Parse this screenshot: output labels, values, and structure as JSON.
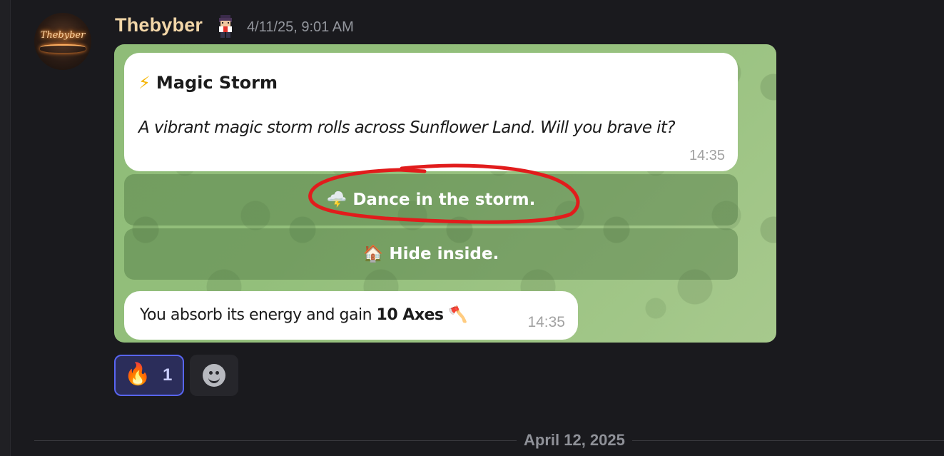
{
  "message": {
    "username": "Thebyber",
    "timestamp": "4/11/25, 9:01 AM",
    "avatar_text": "Thebyber",
    "badge_icon": "pixel-character-badge"
  },
  "embed": {
    "bot_message": {
      "title_icon": "⚡",
      "title": "Magic Storm",
      "description": "A vibrant magic storm rolls across Sunflower Land. Will you brave it?",
      "time": "14:35"
    },
    "buttons": [
      {
        "emoji": "🌩️",
        "label": "Dance in the storm."
      },
      {
        "emoji": "🏠",
        "label": "Hide inside."
      }
    ],
    "reply": {
      "text_before": "You absorb its energy and gain ",
      "bold": "10 Axes",
      "emoji": "🪓",
      "time": "14:35"
    },
    "background_color": "#93bf7b",
    "annotation_color": "#e11c1c"
  },
  "reactions": [
    {
      "emoji": "🔥",
      "count": "1",
      "active": true
    }
  ],
  "add_reaction_icon": "smiley-add-reaction-icon",
  "date_divider": "April 12, 2025"
}
